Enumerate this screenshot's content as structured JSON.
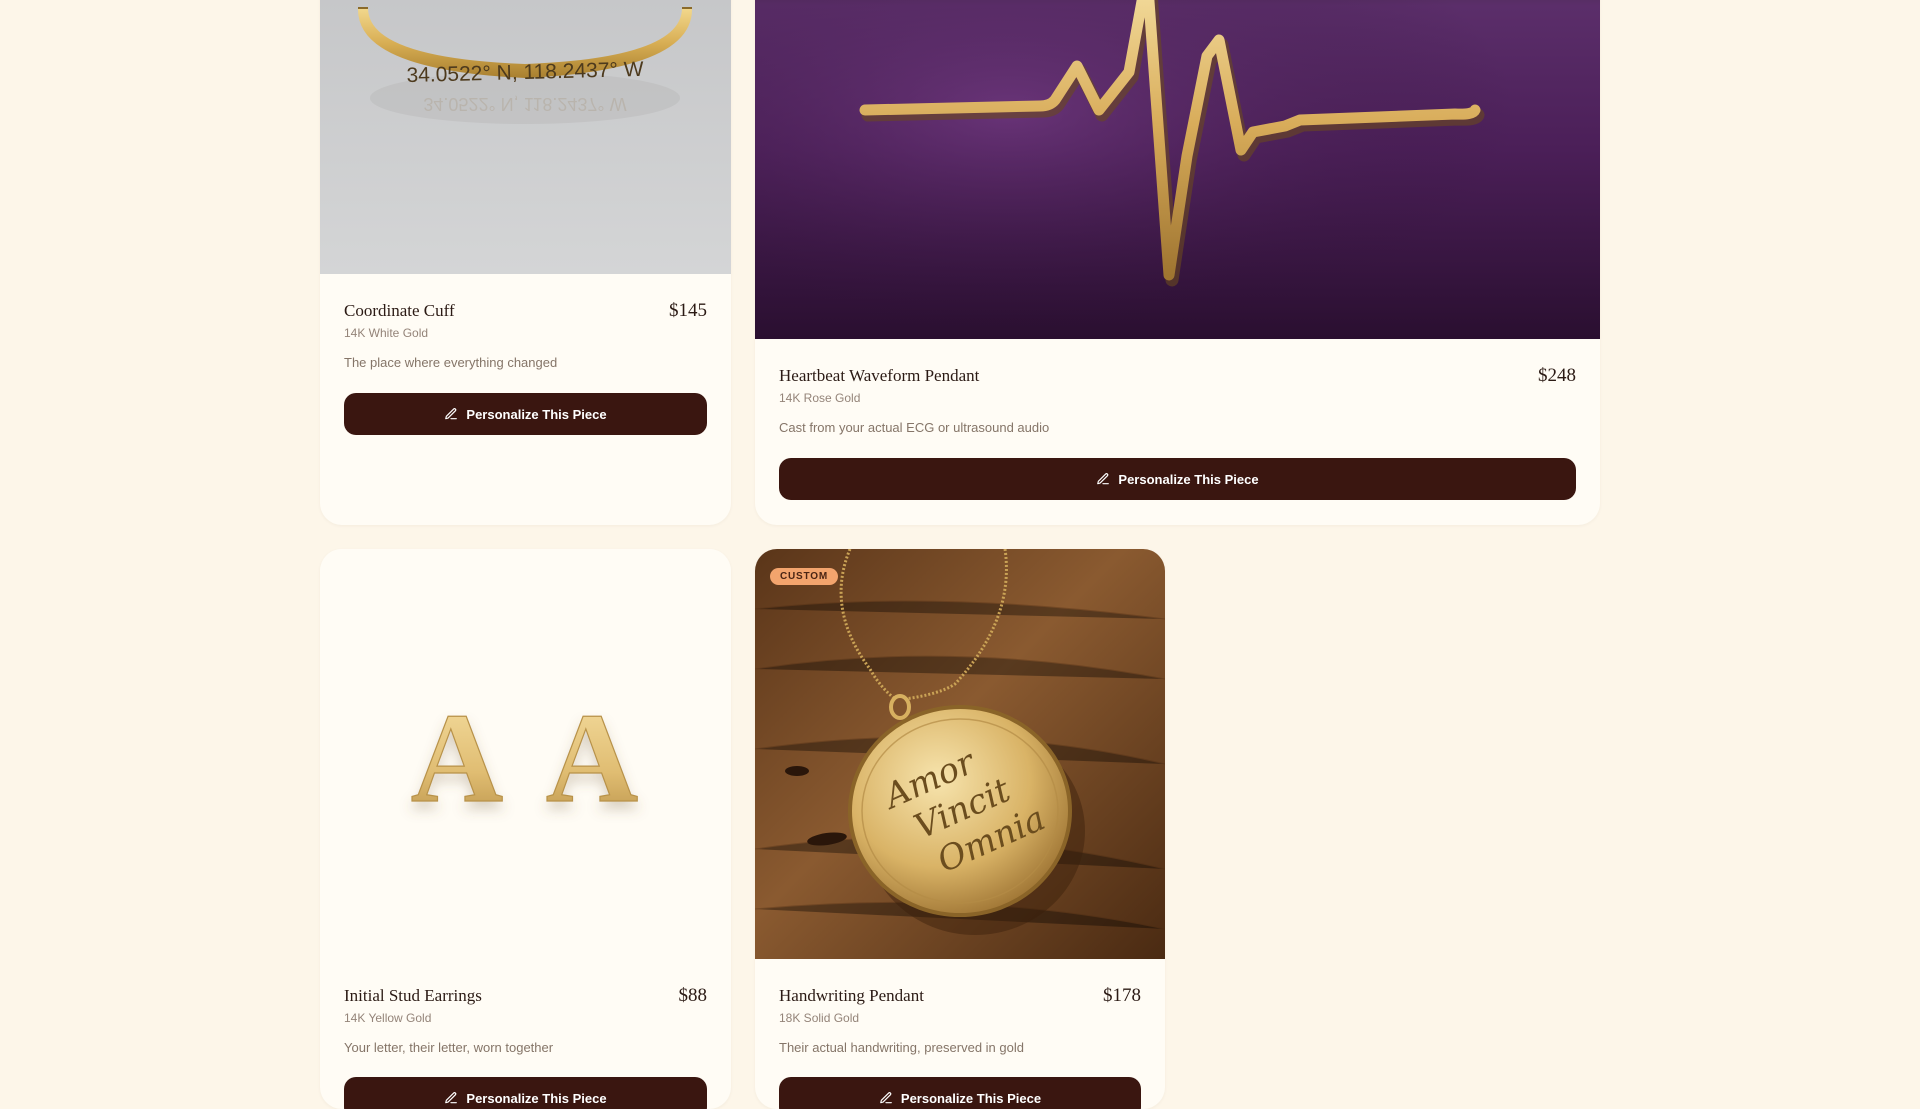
{
  "products": [
    {
      "name": "Coordinate Cuff",
      "metal": "14K White Gold",
      "price": "$145",
      "description": "The place where everything changed",
      "button_label": "Personalize This Piece",
      "engraving": "34.0522° N, 118.2437° W",
      "image": "gold-coordinate-cuff-bracelet"
    },
    {
      "name": "Heartbeat Waveform Pendant",
      "metal": "14K Rose Gold",
      "price": "$248",
      "description": "Cast from your actual ECG or ultrasound audio",
      "button_label": "Personalize This Piece",
      "image": "gold-heartbeat-pendant-on-purple-velvet"
    },
    {
      "name": "Initial Stud Earrings",
      "metal": "14K Yellow Gold",
      "price": "$88",
      "description": "Your letter, their letter, worn together",
      "button_label": "Personalize This Piece",
      "engraving": "A",
      "image": "gold-letter-a-stud-earrings"
    },
    {
      "name": "Handwriting Pendant",
      "metal": "18K Solid Gold",
      "price": "$178",
      "description": "Their actual handwriting, preserved in gold",
      "button_label": "Personalize This Piece",
      "badge": "CUSTOM",
      "engraving": [
        "Amor",
        "Vincit",
        "Omnia"
      ],
      "image": "gold-handwriting-pendant-on-wood"
    }
  ],
  "icons": {
    "button_icon": "pencil-icon"
  },
  "colors": {
    "background": "#fdf6e9",
    "card": "#fffcf5",
    "button": "#3a1610",
    "badge": "#f3a46d"
  }
}
